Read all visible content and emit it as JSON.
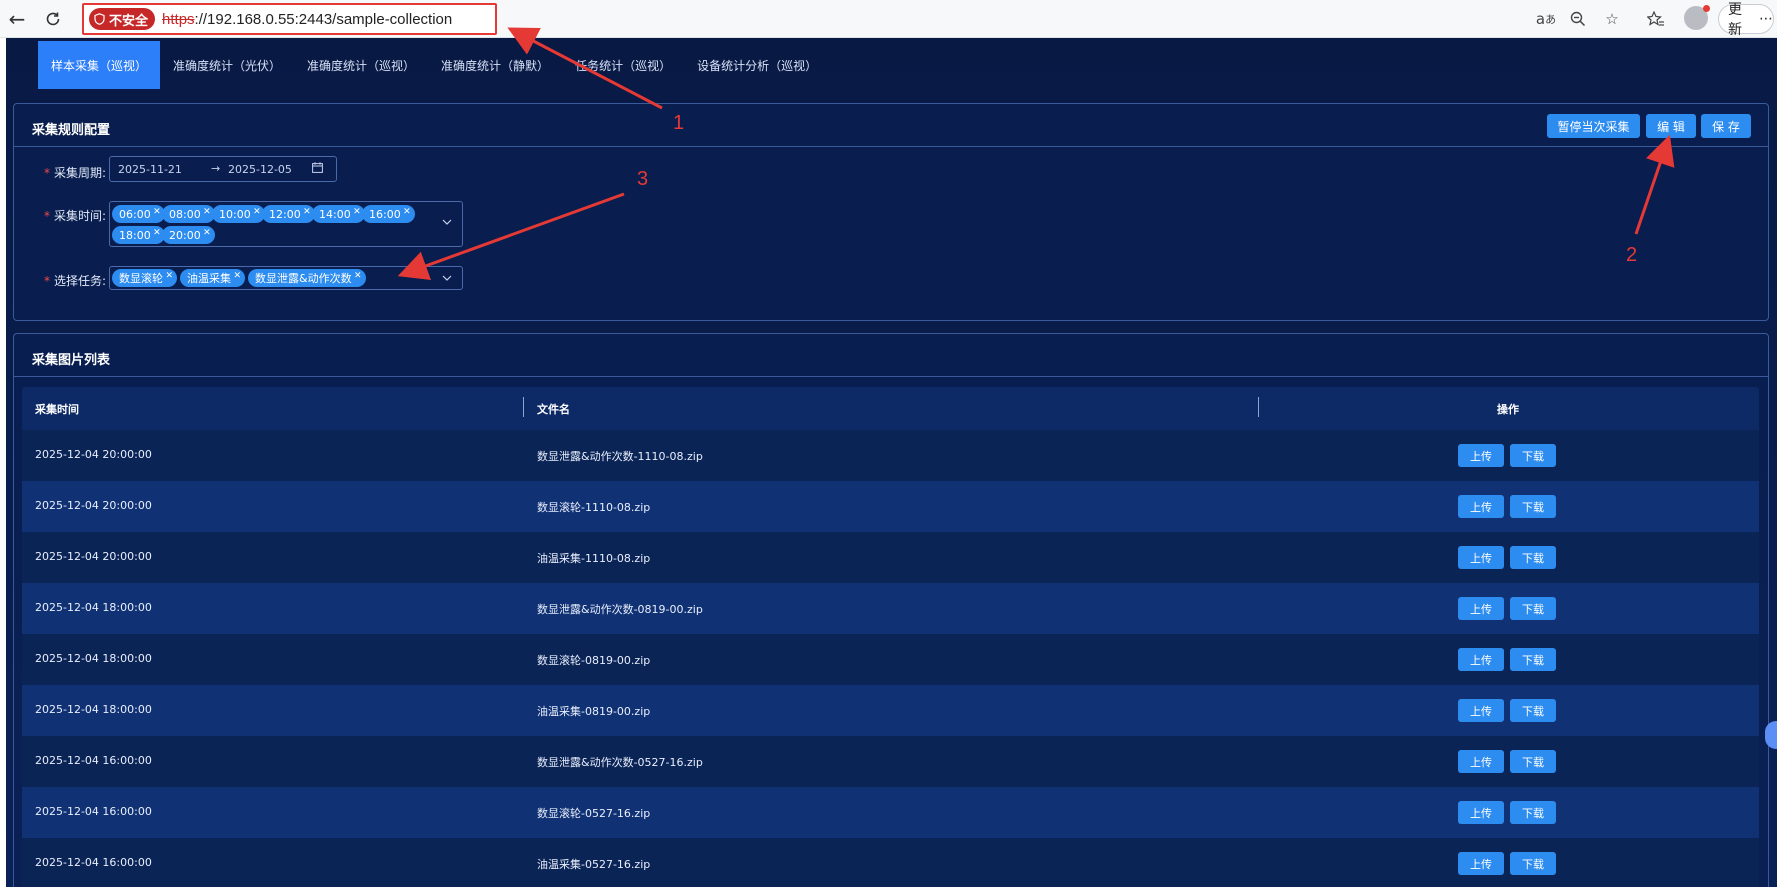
{
  "browser": {
    "security_label": "不安全",
    "url_proto": "https",
    "url_rest": "://192.168.0.55:2443/sample-collection",
    "update_label": "更新"
  },
  "tabs": [
    {
      "label": "样本采集（巡视）",
      "active": true
    },
    {
      "label": "准确度统计（光伏）"
    },
    {
      "label": "准确度统计（巡视）"
    },
    {
      "label": "准确度统计（静默）"
    },
    {
      "label": "任务统计（巡视）"
    },
    {
      "label": "设备统计分析（巡视）"
    }
  ],
  "config": {
    "title": "采集规则配置",
    "buttons": {
      "pause": "暂停当次采集",
      "edit": "编 辑",
      "save": "保 存"
    },
    "period_label": "采集周期:",
    "period_start": "2025-11-21",
    "period_arrow": "→",
    "period_end": "2025-12-05",
    "time_label": "采集时间:",
    "times": [
      "06:00",
      "08:00",
      "10:00",
      "12:00",
      "14:00",
      "16:00",
      "18:00",
      "20:00"
    ],
    "task_label": "选择任务:",
    "tasks": [
      "数显滚轮",
      "油温采集",
      "数显泄露&动作次数"
    ]
  },
  "list": {
    "title": "采集图片列表",
    "columns": [
      "采集时间",
      "文件名",
      "操作"
    ],
    "upload_label": "上传",
    "download_label": "下载",
    "rows": [
      {
        "time": "2025-12-04 20:00:00",
        "file": "数显泄露&动作次数-1110-08.zip"
      },
      {
        "time": "2025-12-04 20:00:00",
        "file": "数显滚轮-1110-08.zip"
      },
      {
        "time": "2025-12-04 20:00:00",
        "file": "油温采集-1110-08.zip"
      },
      {
        "time": "2025-12-04 18:00:00",
        "file": "数显泄露&动作次数-0819-00.zip"
      },
      {
        "time": "2025-12-04 18:00:00",
        "file": "数显滚轮-0819-00.zip"
      },
      {
        "time": "2025-12-04 18:00:00",
        "file": "油温采集-0819-00.zip"
      },
      {
        "time": "2025-12-04 16:00:00",
        "file": "数显泄露&动作次数-0527-16.zip"
      },
      {
        "time": "2025-12-04 16:00:00",
        "file": "数显滚轮-0527-16.zip"
      },
      {
        "time": "2025-12-04 16:00:00",
        "file": "油温采集-0527-16.zip"
      }
    ]
  },
  "annotations": {
    "n1": "1",
    "n2": "2",
    "n3": "3"
  }
}
